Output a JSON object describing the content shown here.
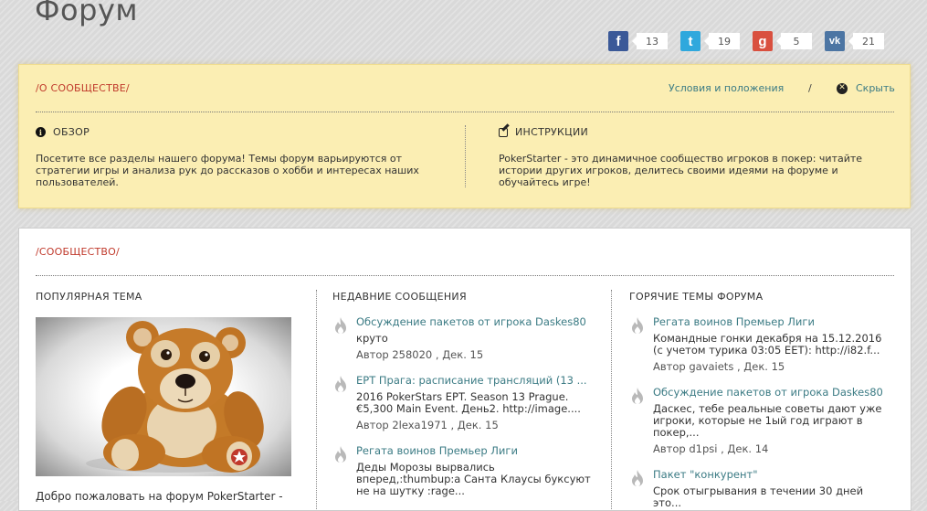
{
  "page": {
    "title": "Форум"
  },
  "share": [
    {
      "network": "facebook",
      "icon": "facebook-icon",
      "glyph": "f",
      "count": "13",
      "color": "#3b5998"
    },
    {
      "network": "twitter",
      "icon": "twitter-icon",
      "glyph": "t",
      "count": "19",
      "color": "#2fa8dd"
    },
    {
      "network": "google-plus",
      "icon": "google-plus-icon",
      "glyph": "g",
      "count": "5",
      "color": "#d9503f"
    },
    {
      "network": "vkontakte",
      "icon": "vk-icon",
      "glyph": "vk",
      "count": "21",
      "color": "#4c75a3"
    }
  ],
  "about": {
    "label": "/О СООБЩЕСТВЕ/",
    "terms_link": "Условия и положения",
    "separator": "/",
    "hide_label": "Скрыть",
    "overview": {
      "heading": "ОБЗОР",
      "text": "Посетите все разделы нашего форума! Темы форум варьируются от стратегии игры и анализа рук до рассказов о хобби и интересах наших пользователей."
    },
    "instructions": {
      "heading": "ИНСТРУКЦИИ",
      "text": "PokerStarter - это динамичное сообщество игроков в покер: читайте истории других игроков, делитесь своими идеями на форуме и обучайтесь игре!"
    }
  },
  "community": {
    "label": "/СООБЩЕСТВО/",
    "popular": {
      "title": "ПОПУЛЯРНАЯ ТЕМА",
      "caption": "Добро пожаловать на форум PokerStarter -"
    },
    "recent": {
      "title": "НЕДАВНИЕ СООБЩЕНИЯ",
      "posts": [
        {
          "title": "Обсуждение пакетов от игрока Daskes80",
          "excerpt": "круто",
          "meta": "Автор 258020 , Дек. 15"
        },
        {
          "title": "EPT Прага: расписание трансляций (13 ...",
          "excerpt": "2016 PokerStars EPT. Season 13 Prague. €5,300 Main Event. День2. http://image....",
          "meta": "Автор 2lexa1971 , Дек. 15"
        },
        {
          "title": "Регата воинов Премьер Лиги",
          "excerpt": "Деды Морозы вырвались вперед,:thumbup:а Санта Клаусы буксуют не на шутку :rage...",
          "meta": ""
        }
      ]
    },
    "hot": {
      "title": "ГОРЯЧИЕ ТЕМЫ ФОРУМА",
      "posts": [
        {
          "title": "Регата воинов Премьер Лиги",
          "excerpt": "Командные гонки декабря на 15.12.2016 (с учетом турика 03:05 EET): http://i82.f...",
          "meta": "Автор gavaiets , Дек. 15"
        },
        {
          "title": "Обсуждение пакетов от игрока Daskes80",
          "excerpt": "Даскес, тебе реальные советы дают уже игроки, которые не 1ый год играют в покер,...",
          "meta": "Автор d1psi , Дек. 14"
        },
        {
          "title": "Пакет \"конкурент\"",
          "excerpt": "Срок отыгрывания в течении 30 дней это...",
          "meta": ""
        }
      ]
    }
  }
}
